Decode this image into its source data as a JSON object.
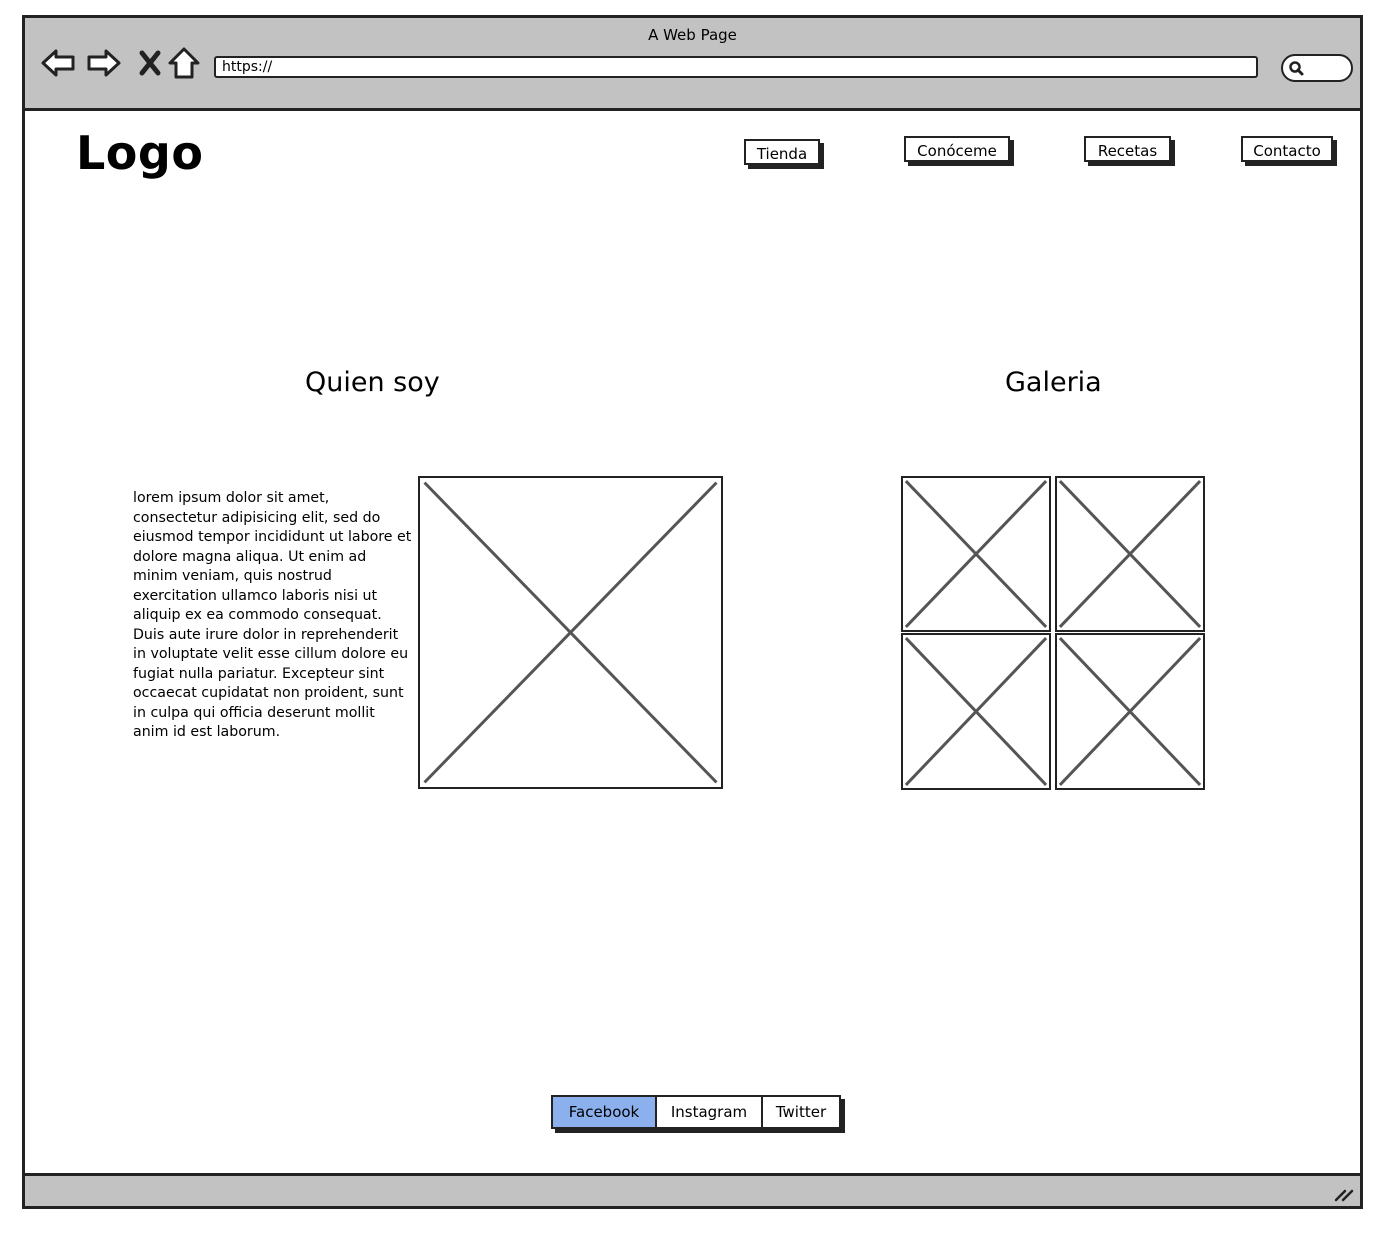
{
  "browser": {
    "window_title": "A Web Page",
    "url": "https://",
    "icons": [
      "back-icon",
      "forward-icon",
      "close-icon",
      "home-icon",
      "search-icon",
      "resize-icon"
    ]
  },
  "header": {
    "logo": "Logo",
    "nav": [
      {
        "label": "Tienda"
      },
      {
        "label": "Conóceme"
      },
      {
        "label": "Recetas"
      },
      {
        "label": "Contacto"
      }
    ]
  },
  "about": {
    "title": "Quien soy",
    "text": "lorem ipsum dolor sit amet, consectetur adipisicing elit, sed do eiusmod tempor incididunt ut labore et dolore magna aliqua. Ut enim ad minim veniam, quis nostrud exercitation ullamco laboris nisi ut aliquip ex ea commodo consequat. Duis aute irure dolor in reprehenderit in voluptate velit esse cillum dolore eu fugiat nulla pariatur. Excepteur sint occaecat cupidatat non proident, sunt in culpa qui officia deserunt mollit anim id est laborum."
  },
  "gallery": {
    "title": "Galeria"
  },
  "footer": {
    "social": [
      {
        "label": "Facebook",
        "active": true
      },
      {
        "label": "Instagram",
        "active": false
      },
      {
        "label": "Twitter",
        "active": false
      }
    ],
    "active_color": "#8cb0ee"
  }
}
